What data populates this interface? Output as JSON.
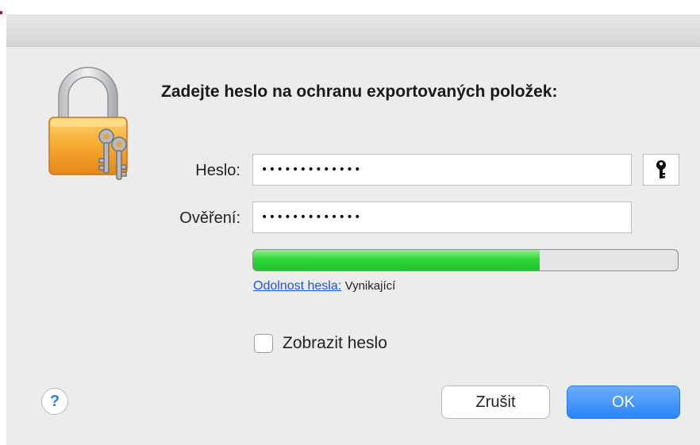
{
  "dialog": {
    "prompt": "Zadejte heslo na ochranu exportovaných položek:",
    "password_label": "Heslo:",
    "password_value": "•••••••••••••",
    "verify_label": "Ověření:",
    "verify_value": "•••••••••••••",
    "strength": {
      "link_label": "Odolnost hesla:",
      "value": "Vynikající",
      "fill_fraction": 0.675,
      "fill_color": "#2fd63a"
    },
    "show_password_label": "Zobrazit heslo",
    "show_password_checked": false,
    "help_glyph": "?",
    "cancel_label": "Zrušit",
    "ok_label": "OK",
    "accent_color": "#2b84f8"
  },
  "icons": {
    "lock": "lock-with-keys-icon",
    "key": "key-icon",
    "help": "help-icon"
  }
}
